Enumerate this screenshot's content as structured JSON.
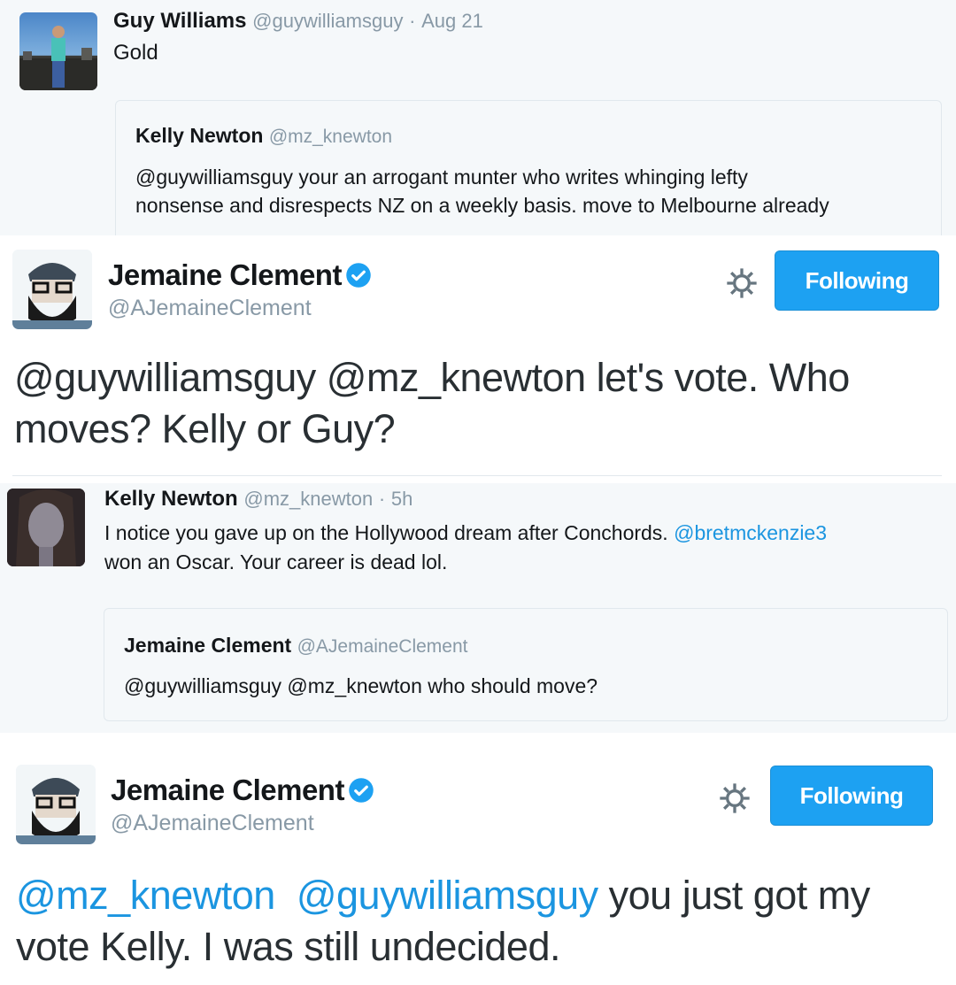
{
  "tweet1": {
    "name": "Guy Williams",
    "handle": "@guywilliamsguy",
    "sep": "·",
    "date": "Aug 21",
    "text": "Gold",
    "quote": {
      "name": "Kelly Newton",
      "handle": "@mz_knewton",
      "line1": "@guywilliamsguy your an arrogant munter who writes whinging lefty",
      "line2": "nonsense and disrespects NZ on a weekly basis. move to Melbourne already"
    }
  },
  "tweet2": {
    "name": "Jemaine Clement",
    "handle": "@AJemaineClement",
    "follow_label": "Following",
    "line1": "@guywilliamsguy @mz_knewton let's vote. Who",
    "line2": "moves? Kelly or Guy?"
  },
  "tweet3": {
    "name": "Kelly Newton",
    "handle": "@mz_knewton",
    "sep": "·",
    "time": "5h",
    "line1_text": "I notice you gave up on the Hollywood dream after Conchords.",
    "line1_link": "@bretmckenzie3",
    "line2": "won an Oscar. Your career is dead lol.",
    "quote": {
      "name": "Jemaine Clement",
      "handle": "@AJemaineClement",
      "text": "@guywilliamsguy @mz_knewton who should move?"
    }
  },
  "tweet4": {
    "name": "Jemaine Clement",
    "handle": "@AJemaineClement",
    "follow_label": "Following",
    "mention1": "@mz_knewton",
    "mention2": "@guywilliamsguy",
    "line1_rest": "you just got my",
    "line2": "vote Kelly. I was still undecided."
  },
  "icons": {
    "gear": "gear-icon",
    "verified": "verified-badge-icon"
  },
  "colors": {
    "link": "#1b95e0",
    "muted": "#8899a6",
    "button": "#1da1f2",
    "panel": "#f5f8fa"
  }
}
